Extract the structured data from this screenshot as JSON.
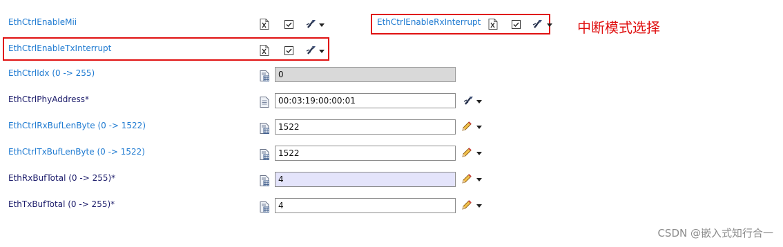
{
  "params": {
    "enable_mii": {
      "label": "EthCtrlEnableMii"
    },
    "enable_tx_interrupt": {
      "label": "EthCtrlEnableTxInterrupt"
    },
    "enable_rx_interrupt": {
      "label": "EthCtrlEnableRxInterrupt"
    },
    "idx": {
      "label": "EthCtrlIdx (0 -> 255)",
      "value": "0"
    },
    "phy_address": {
      "label": "EthCtrlPhyAddress*",
      "value": "00:03:19:00:00:01"
    },
    "rx_buf_len": {
      "label": "EthCtrlRxBufLenByte (0 -> 1522)",
      "value": "1522"
    },
    "tx_buf_len": {
      "label": "EthCtrlTxBufLenByte (0 -> 1522)",
      "value": "1522"
    },
    "rx_buf_total": {
      "label": "EthRxBufTotal (0 -> 255)*",
      "value": "4"
    },
    "tx_buf_total": {
      "label": "EthTxBufTotal (0 -> 255)*",
      "value": "4"
    }
  },
  "annotation": {
    "text": "中断模式选择"
  },
  "watermark": {
    "text": "CSDN @嵌入式知行合一"
  },
  "icons": {
    "xml": "xml-file-icon",
    "checkbox": "checkbox-checked-icon",
    "wand": "wand-icon",
    "edit": "pencil-icon",
    "doc": "document-icon",
    "doc_hash": "document-hash-icon",
    "caret": "chevron-down-icon"
  },
  "colors": {
    "highlight": "#e01010",
    "label_blue": "#1e7ad1",
    "label_dark": "#1b1b6a"
  }
}
